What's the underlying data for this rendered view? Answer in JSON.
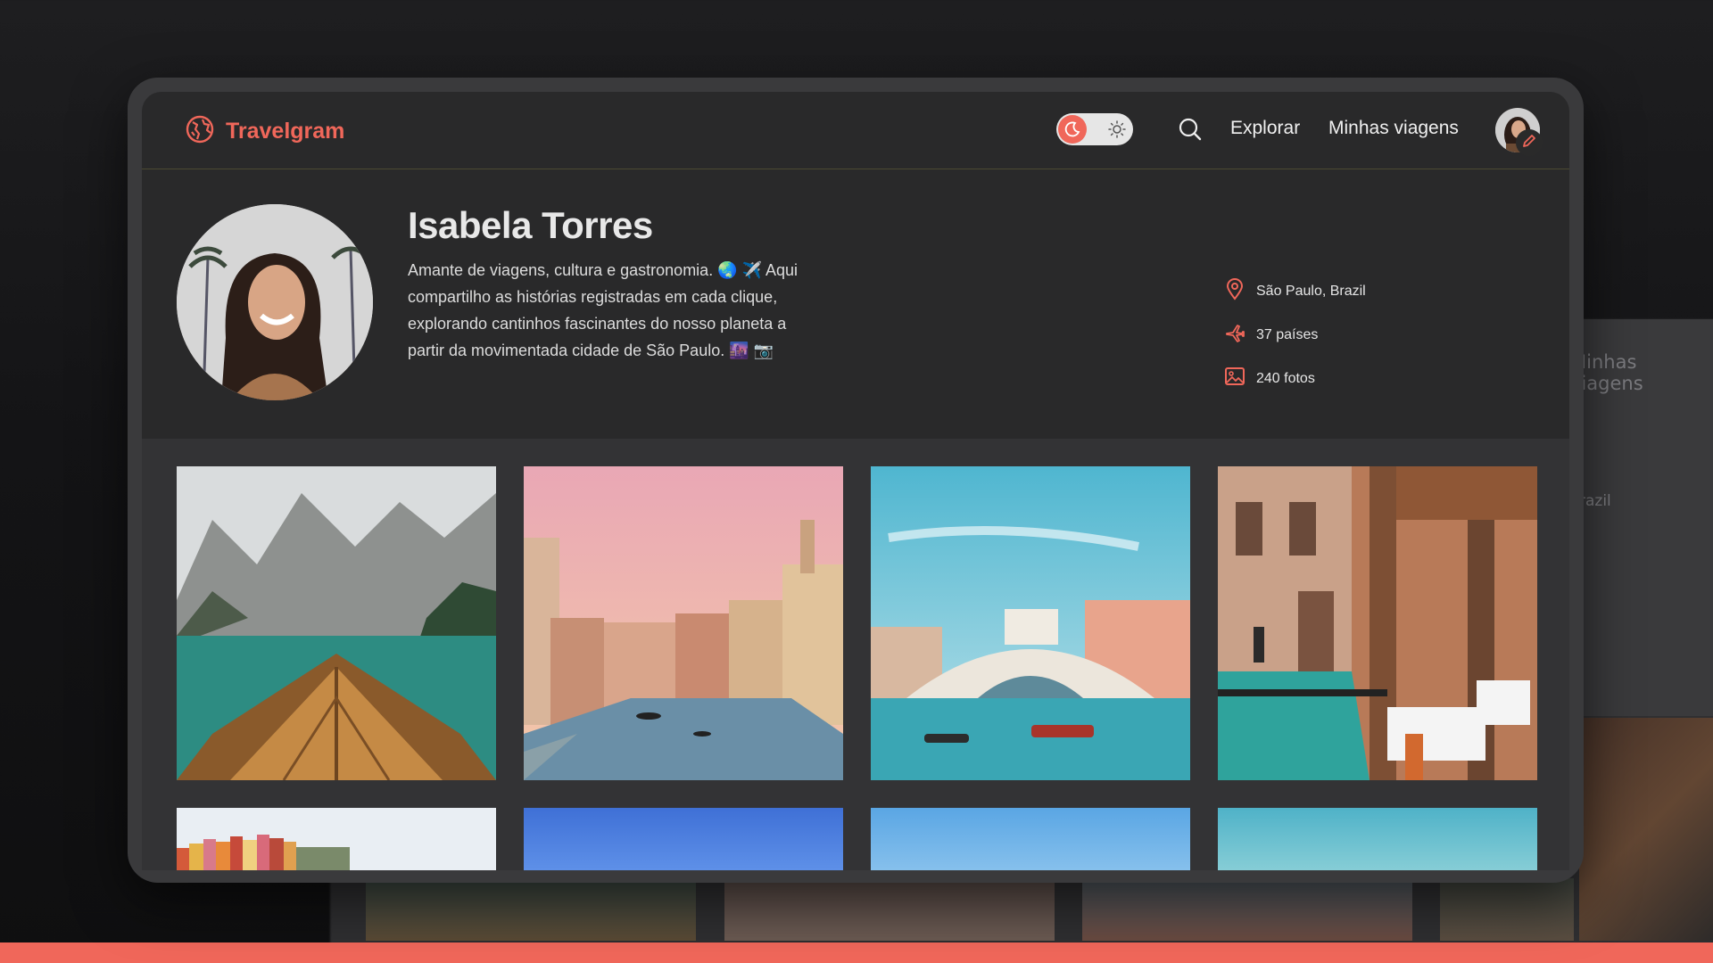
{
  "app": {
    "title": "Travelgram",
    "accent": "#f0675a"
  },
  "navbar": {
    "theme_toggle": {
      "state": "dark"
    },
    "links": [
      "Explorar",
      "Minhas viagens"
    ],
    "icons": [
      "globe-icon",
      "moon-icon",
      "sun-icon",
      "search-icon",
      "pencil-icon"
    ]
  },
  "profile": {
    "name": "Isabela Torres",
    "bio": "Amante de viagens, cultura e gastronomia. 🌏 ✈️ Aqui compartilho as histórias registradas em cada clique, explorando cantinhos fascinantes do nosso planeta a partir da movimentada cidade de São Paulo. 🌆 📷",
    "stats": {
      "location": "São Paulo, Brazil",
      "countries": "37 países",
      "photos": "240 fotos"
    }
  },
  "gallery": {
    "photos": [
      "mountain-lake-boat",
      "venice-canal-sunset",
      "rialto-bridge",
      "venice-cafe-canal",
      "colorful-coastal-houses",
      "blue-sky",
      "sky-sea",
      "coastal-sky"
    ]
  },
  "background": {
    "ghost_link": "Minhas viagens",
    "ghost_location_fragment": "razil"
  }
}
